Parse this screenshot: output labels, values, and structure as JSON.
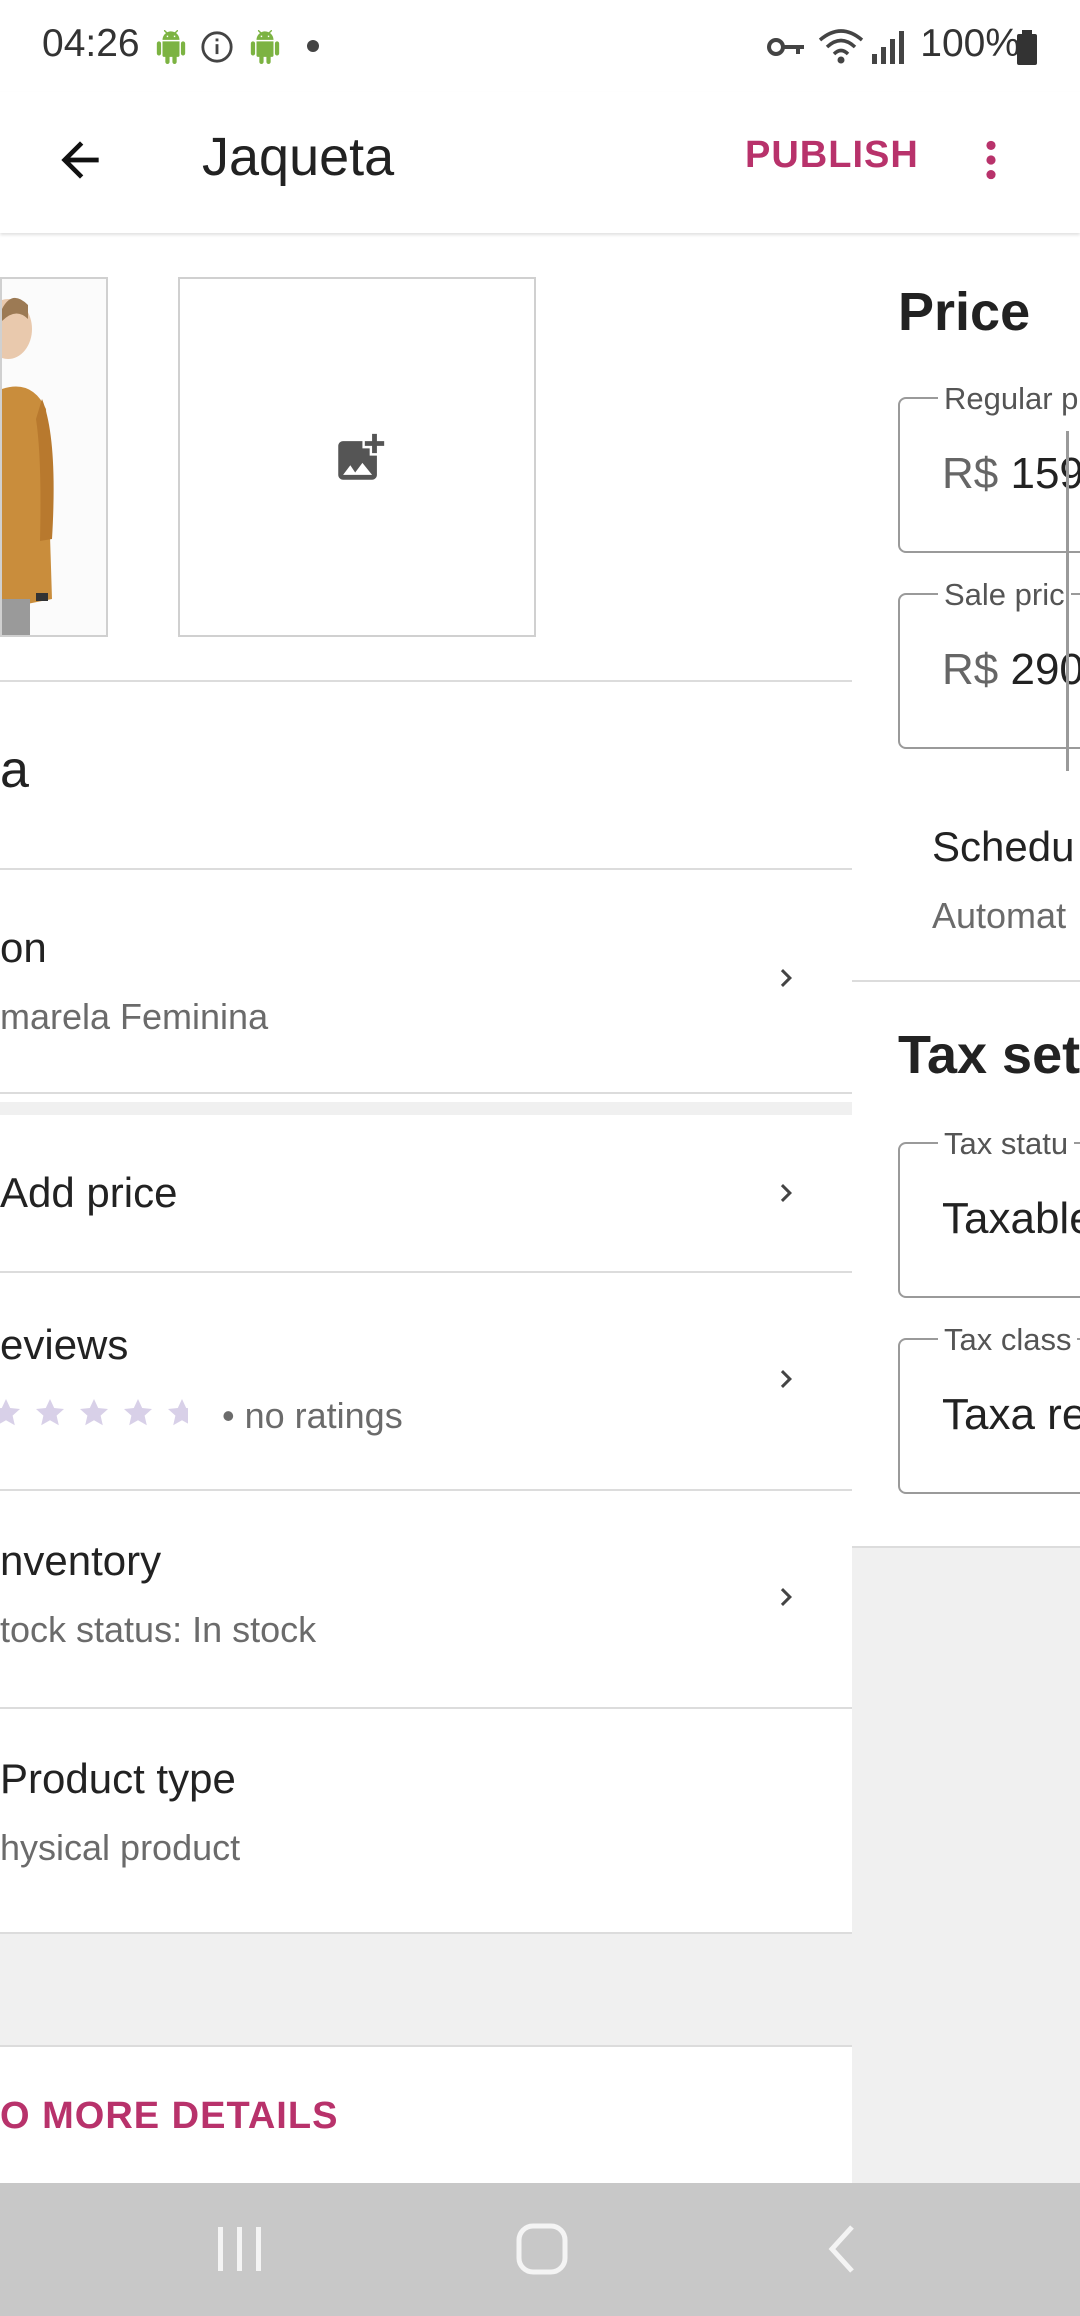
{
  "status_bar": {
    "time": "04:26",
    "battery": "100%"
  },
  "app_bar": {
    "title": "Jaqueta",
    "publish": "PUBLISH"
  },
  "left_panel": {
    "name_fragment": "a",
    "description": {
      "title": "on",
      "value": "marela Feminina"
    },
    "price_row": {
      "title": "Add price"
    },
    "reviews": {
      "title": "eviews",
      "rating_text": "• no ratings"
    },
    "inventory": {
      "title": "nventory",
      "value": "tock status: In stock"
    },
    "product_type": {
      "title": "Product type",
      "value": "hysical product"
    },
    "more_details": "O MORE DETAILS"
  },
  "right_panel": {
    "price_heading": "Price",
    "regular_price": {
      "label": "Regular p",
      "currency": "R$",
      "value": "159"
    },
    "sale_price": {
      "label": "Sale pric",
      "currency": "R$",
      "value": "290"
    },
    "schedule": {
      "title": "Schedu",
      "value": "Automat"
    },
    "tax_heading": "Tax set",
    "tax_status": {
      "label": "Tax statu",
      "value": "Taxable"
    },
    "tax_class": {
      "label": "Tax class",
      "value": "Taxa re"
    }
  },
  "colors": {
    "accent": "#b8326b",
    "rating_star": "#d8d0e8"
  }
}
